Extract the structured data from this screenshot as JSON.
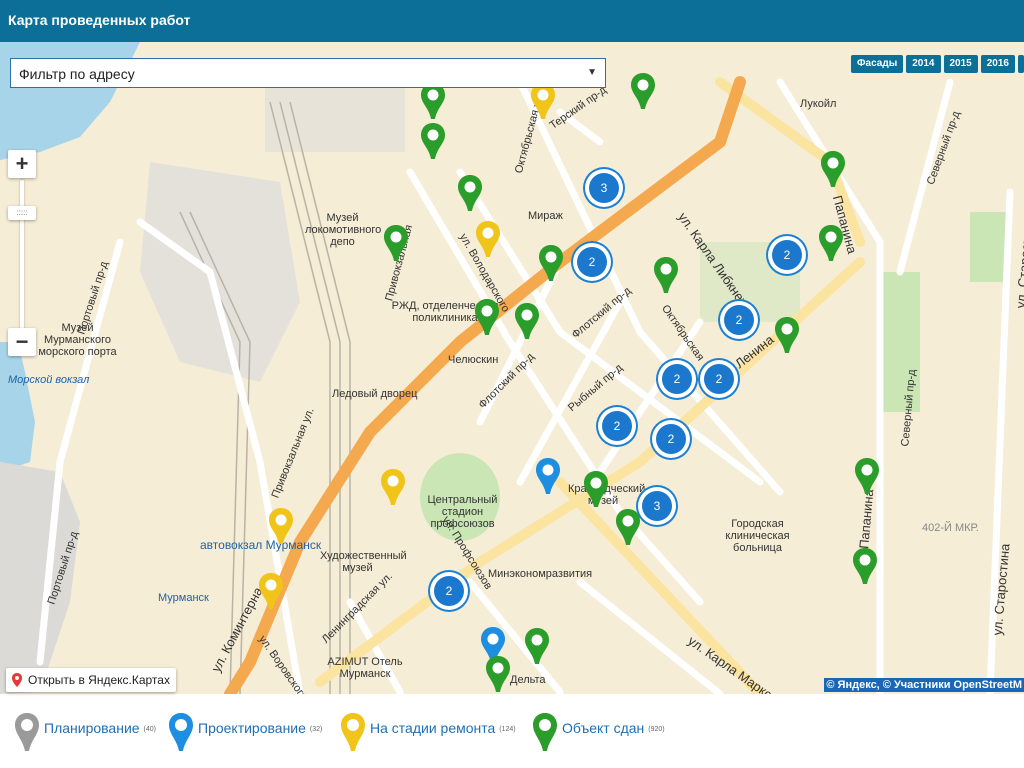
{
  "header": {
    "title": "Карта проведенных работ"
  },
  "filter": {
    "value": "Фильтр по адресу",
    "caret_icon": "triangle-down"
  },
  "year_buttons": [
    "Фасады",
    "2014",
    "2015",
    "2016"
  ],
  "zoom": {
    "plus": "+",
    "minus": "−",
    "handle": ":::::"
  },
  "open_yandex": {
    "label": "Открыть в Яндекс.Картах"
  },
  "copyright": "© Яндекс, © Участники OpenStreetM",
  "legend": [
    {
      "label": "Планирование",
      "count": "(40)",
      "color": "#9a9a9a"
    },
    {
      "label": "Проектирование",
      "count": "(32)",
      "color": "#1e8ee0"
    },
    {
      "label": "На стадии ремонта",
      "count": "(124)",
      "color": "#f0c419"
    },
    {
      "label": "Объект сдан",
      "count": "(920)",
      "color": "#2a9d2a"
    }
  ],
  "clusters": [
    "3",
    "2",
    "2",
    "2",
    "2",
    "2",
    "2",
    "2",
    "3",
    "2"
  ],
  "pois": {
    "lukoil": "Лукойл",
    "museum_depo": "Музей локомотивного депо",
    "mirazh": "Мираж",
    "rzd": "РЖД, отделенческая поликлиника",
    "chelyuskin": "Челюскин",
    "museum_port": "Музей Мурманского морского порта",
    "morskoy_vokzal": "Морской вокзал",
    "ice_palace": "Ледовый дворец",
    "stadium": "Центральный стадион профсоюзов",
    "kraeved_museum": "Краеведческий музей",
    "gor_bolnica": "Городская клиническая больница",
    "avtovokzal": "автовокзал Мурманск",
    "art_museum": "Художественный музей",
    "minekonom": "Минэкономразвития",
    "murmansk_station": "Мурманск",
    "azimut": "AZIMUT Отель Мурманск",
    "delta": "Дельта",
    "mkr402": "402-Й МКР."
  },
  "streets": {
    "portovy1": "Портовый пр-д",
    "portovy2": "Портовый пр-д",
    "oktyabrskaya1": "Октябрьская ул.",
    "terskiy": "Терский пр-д",
    "karla_libknekhta": "ул. Карла Либкнехта",
    "papanina1": "Папанина",
    "severny1": "Северный пр-д",
    "starostina1": "ул. Старости",
    "volodarskogo": "ул. Володарского",
    "privokzalnaya1": "Привокзальная",
    "flotsky1": "Флотский пр-д",
    "flotsky2": "Флотский пр-д",
    "rybny": "Рыбный пр-д",
    "oktyabrskaya2": "Октябрьская",
    "lenina": "Ленина",
    "privokzalnaya2": "Привокзальная ул.",
    "kominterna": "ул. Коминтерна",
    "profsoyuzov": "ул. Профсоюзов",
    "leningradskaya": "Ленинградская ул.",
    "vorovskogo": "ул. Воровского",
    "karla_marksa": "ул. Карла Маркса",
    "papanina2": "ул. Папанина",
    "severny2": "Северный пр-д",
    "starostina2": "ул. Старостина"
  }
}
